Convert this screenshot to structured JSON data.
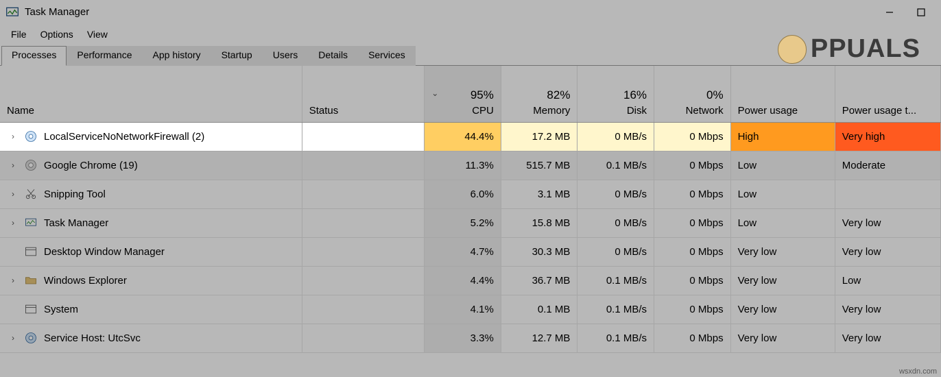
{
  "window": {
    "title": "Task Manager"
  },
  "menubar": {
    "file": "File",
    "options": "Options",
    "view": "View"
  },
  "tabs": {
    "processes": "Processes",
    "performance": "Performance",
    "app_history": "App history",
    "startup": "Startup",
    "users": "Users",
    "details": "Details",
    "services": "Services"
  },
  "columns": {
    "name": "Name",
    "status": "Status",
    "cpu_top": "95%",
    "cpu_label": "CPU",
    "mem_top": "82%",
    "mem_label": "Memory",
    "disk_top": "16%",
    "disk_label": "Disk",
    "net_top": "0%",
    "net_label": "Network",
    "power": "Power usage",
    "power_trend": "Power usage t..."
  },
  "rows": [
    {
      "name": "LocalServiceNoNetworkFirewall (2)",
      "cpu": "44.4%",
      "mem": "17.2 MB",
      "disk": "0 MB/s",
      "net": "0 Mbps",
      "power": "High",
      "power_trend": "Very high",
      "icon": "gear"
    },
    {
      "name": "Google Chrome (19)",
      "cpu": "11.3%",
      "mem": "515.7 MB",
      "disk": "0.1 MB/s",
      "net": "0 Mbps",
      "power": "Low",
      "power_trend": "Moderate",
      "icon": "chrome"
    },
    {
      "name": "Snipping Tool",
      "cpu": "6.0%",
      "mem": "3.1 MB",
      "disk": "0 MB/s",
      "net": "0 Mbps",
      "power": "Low",
      "power_trend": "",
      "icon": "scissors"
    },
    {
      "name": "Task Manager",
      "cpu": "5.2%",
      "mem": "15.8 MB",
      "disk": "0 MB/s",
      "net": "0 Mbps",
      "power": "Low",
      "power_trend": "Very low",
      "icon": "taskmgr"
    },
    {
      "name": "Desktop Window Manager",
      "cpu": "4.7%",
      "mem": "30.3 MB",
      "disk": "0 MB/s",
      "net": "0 Mbps",
      "power": "Very low",
      "power_trend": "Very low",
      "icon": "dwm"
    },
    {
      "name": "Windows Explorer",
      "cpu": "4.4%",
      "mem": "36.7 MB",
      "disk": "0.1 MB/s",
      "net": "0 Mbps",
      "power": "Very low",
      "power_trend": "Low",
      "icon": "explorer"
    },
    {
      "name": "System",
      "cpu": "4.1%",
      "mem": "0.1 MB",
      "disk": "0.1 MB/s",
      "net": "0 Mbps",
      "power": "Very low",
      "power_trend": "Very low",
      "icon": "system"
    },
    {
      "name": "Service Host: UtcSvc",
      "cpu": "3.3%",
      "mem": "12.7 MB",
      "disk": "0.1 MB/s",
      "net": "0 Mbps",
      "power": "Very low",
      "power_trend": "Very low",
      "icon": "gear"
    }
  ],
  "watermark": "PPUALS",
  "source_note": "wsxdn.com"
}
